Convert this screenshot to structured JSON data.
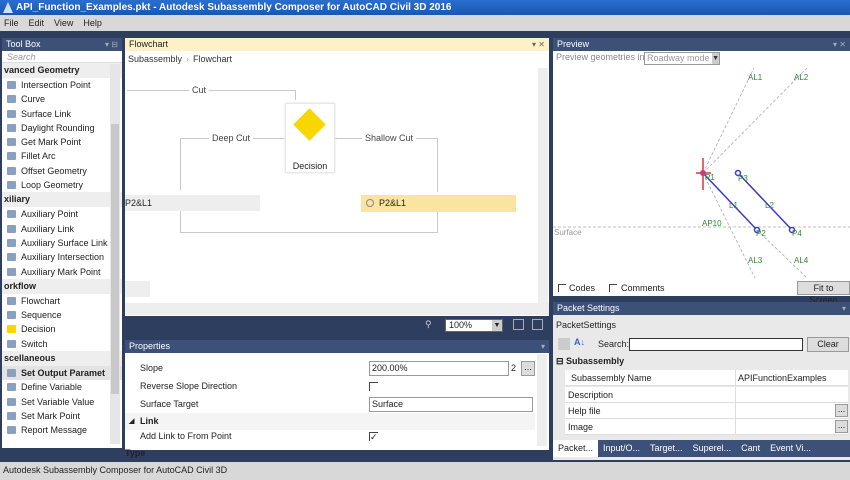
{
  "window": {
    "title": "API_Function_Examples.pkt - Autodesk Subassembly Composer for AutoCAD Civil 3D 2016"
  },
  "menu": [
    "File",
    "Edit",
    "View",
    "Help"
  ],
  "toolbox": {
    "title": "Tool Box",
    "search_placeholder": "Search",
    "groups": [
      {
        "label": "vanced Geometry",
        "items": [
          "Intersection Point",
          "Curve",
          "Surface Link",
          "Daylight Rounding",
          "Get Mark Point",
          "Fillet Arc",
          "Offset Geometry",
          "Loop Geometry"
        ]
      },
      {
        "label": "xiliary",
        "items": [
          "Auxiliary Point",
          "Auxiliary Link",
          "Auxiliary Surface Link",
          "Auxiliary Intersection",
          "Auxiliary Mark Point"
        ]
      },
      {
        "label": "orkflow",
        "items": [
          "Flowchart",
          "Sequence",
          "Decision",
          "Switch"
        ]
      },
      {
        "label": "scellaneous",
        "items": [
          "Set Output Paramet",
          "Define Variable",
          "Set Variable Value",
          "Set Mark Point",
          "Report Message"
        ]
      }
    ]
  },
  "flowchart": {
    "title": "Flowchart",
    "breadcrumb": [
      "Subassembly",
      "Flowchart"
    ],
    "cut_label": "Cut",
    "deep_cut_label": "Deep Cut",
    "shallow_cut_label": "Shallow Cut",
    "decision_label": "Decision",
    "left_node": "P2&L1",
    "right_node": "P2&L1",
    "zoom": "100%"
  },
  "properties": {
    "title": "Properties",
    "rows": [
      {
        "key": "Slope",
        "value": "200.00%",
        "extra": "2"
      },
      {
        "key": "Reverse Slope Direction",
        "checked": false
      },
      {
        "key": "Surface Target",
        "value": "Surface"
      }
    ],
    "link_section": "Link",
    "add_link": {
      "key": "Add Link to From Point",
      "checked": true
    },
    "type_section": "Type"
  },
  "preview": {
    "title": "Preview",
    "mode_label": "Preview geometries in",
    "mode_value": "Roadway mode",
    "labels": {
      "al1": "AL1",
      "al2": "AL2",
      "al3": "AL3",
      "al4": "AL4",
      "ap10": "AP10",
      "p2": "P2",
      "p3": "P3",
      "p4": "P4",
      "l1": "L1",
      "l2": "L2",
      "p1": "P1",
      "surface": "Surface"
    },
    "codes": "Codes",
    "comments": "Comments",
    "fit": "Fit to Screen",
    "colors": {
      "link": "#3a3acc",
      "label": "#2e8b2e",
      "marker": "#e03040"
    }
  },
  "packet": {
    "title": "Packet Settings",
    "subtitle": "PacketSettings",
    "search_label": "Search:",
    "search_value": "",
    "clear": "Clear",
    "section": "Subassembly",
    "rows": [
      {
        "key": "Subassembly Name",
        "value": "APIFunctionExamples"
      },
      {
        "key": "Description",
        "value": ""
      },
      {
        "key": "Help file",
        "value": ""
      },
      {
        "key": "Image",
        "value": ""
      }
    ],
    "tabs": [
      "Packet...",
      "Input/O...",
      "Target...",
      "Superel...",
      "Cant",
      "Event Vi..."
    ]
  },
  "status": "Autodesk Subassembly Composer for AutoCAD Civil 3D"
}
